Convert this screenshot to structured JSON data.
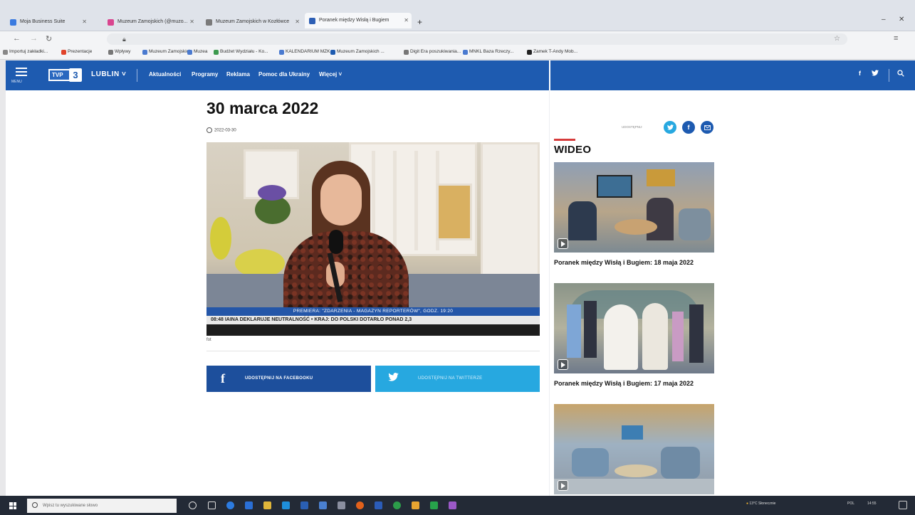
{
  "browser": {
    "tabs": [
      {
        "label": "Moja Business Suite",
        "color": "#3b7be0"
      },
      {
        "label": "Muzeum Zamojskich (@muzo...",
        "color": "#d9458f"
      },
      {
        "label": "Muzeum Zamojskich w Kozłówce",
        "color": "#7a7a7a"
      },
      {
        "label": "Poranek między Wisłą i Bugiem",
        "color": "#2d5fb5"
      }
    ],
    "new_tab": "+",
    "bookmarks": [
      {
        "label": "Importuj zakładki...",
        "color": "#888"
      },
      {
        "label": "Prezentacje",
        "color": "#e0442c"
      },
      {
        "label": "Wpływy",
        "color": "#777"
      },
      {
        "label": "Muzeum Zamojskich",
        "color": "#4a7ad0"
      },
      {
        "label": "Muzea",
        "color": "#4a7ad0"
      },
      {
        "label": "Budżet Wydziału - Ko...",
        "color": "#3d9a4f"
      },
      {
        "label": "KALENDARIUM MZK",
        "color": "#4a7ad0"
      },
      {
        "label": "Muzeum Zamojskich ...",
        "color": "#1e5bb0"
      },
      {
        "label": "Digit Era poszukiwania...",
        "color": "#777"
      },
      {
        "label": "MNKL Baza Rzeczy...",
        "color": "#4a7ad0"
      },
      {
        "label": "Zamek T-Andy Mob...",
        "color": "#222"
      }
    ]
  },
  "site": {
    "logo_text": "TVP",
    "logo_num": "3",
    "menu_label": "MENU",
    "region": "LUBLIN",
    "nav": [
      "Aktualności",
      "Programy",
      "Reklama",
      "Pomoc dla Ukrainy",
      "Więcej"
    ],
    "social_f": "f",
    "social_t": "♥",
    "search_icon": "⚲"
  },
  "article": {
    "title": "30 marca 2022",
    "date": "2022-03-30",
    "caption": "fot",
    "ticker_top": "PREMIERA: \"ZDARZENIA - MAGAZYN REPORTERÓW\", GODZ. 19:20",
    "ticker_bottom": "08:48  IAINA DEKLARUJE NEUTRALNOŚĆ     •     KRAJ: DO POLSKI DOTARŁO PONAD 2,3",
    "share_facebook": "UDOSTĘPNIJ NA FACEBOOKU",
    "share_twitter": "UDOSTĘPNIJ NA TWITTERZE"
  },
  "sidebar": {
    "share_label": "UDOSTĘPNIJ",
    "section_title": "WIDEO",
    "videos": [
      {
        "title": ""
      },
      {
        "title": "Poranek między Wisłą i Bugiem: 18 maja 2022"
      },
      {
        "title": "Poranek między Wisłą i Bugiem: 17 maja 2022"
      }
    ]
  },
  "taskbar": {
    "search_placeholder": "Wpisz tu wyszukiwane słowo",
    "weather": "13°C  Słonecznie",
    "time": "14:55",
    "lang": "POL"
  },
  "colors": {
    "brand_blue": "#1e5bb0",
    "facebook": "#1d4f9c",
    "twitter": "#27a8e0",
    "accent_red": "#d63b3b"
  }
}
